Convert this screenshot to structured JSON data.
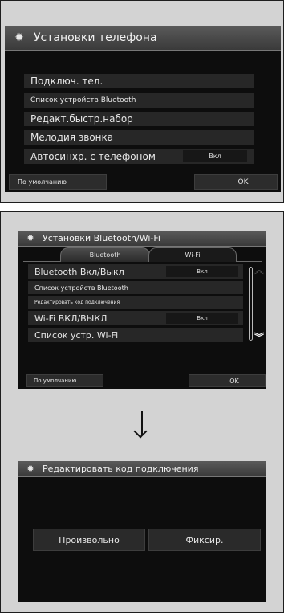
{
  "screen1": {
    "title": "Установки телефона",
    "items": [
      {
        "label": "Подключ. тел."
      },
      {
        "label": "Список устройств Bluetooth"
      },
      {
        "label": "Редакт.быстр.набор"
      },
      {
        "label": "Мелодия звонка"
      },
      {
        "label": "Автосинхр. с телефоном",
        "value": "Вкл"
      }
    ],
    "default_button": "По умолчанию",
    "ok_button": "OK"
  },
  "screen2": {
    "title": "Установки Bluetooth/Wi-Fi",
    "tabs": [
      {
        "label": "Bluetooth",
        "active": true
      },
      {
        "label": "Wi-Fi",
        "active": false
      }
    ],
    "items": [
      {
        "label": "Bluetooth Вкл/Выкл",
        "value": "Вкл"
      },
      {
        "label": "Список устройств Bluetooth"
      },
      {
        "label": "Редактировать код подключения"
      },
      {
        "label": "Wi-Fi ВКЛ/ВЫКЛ",
        "value": "Вкл"
      },
      {
        "label": "Список устр. Wi-Fi"
      }
    ],
    "default_button": "По умолчанию",
    "ok_button": "OK",
    "icons": [
      "scroll-up-icon",
      "scroll-down-icon"
    ]
  },
  "screen3": {
    "title": "Редактировать код подключения",
    "option_random": "Произвольно",
    "option_fixed": "Фиксир."
  },
  "icons": {
    "gear": "gear-icon",
    "transition_arrow": "arrow-down-icon"
  },
  "colors": {
    "screen_bg": "#0d0d0d",
    "title_bar": "#4a4a4a",
    "row_bg": "#272727",
    "panel_bg": "#d3d3d3"
  }
}
